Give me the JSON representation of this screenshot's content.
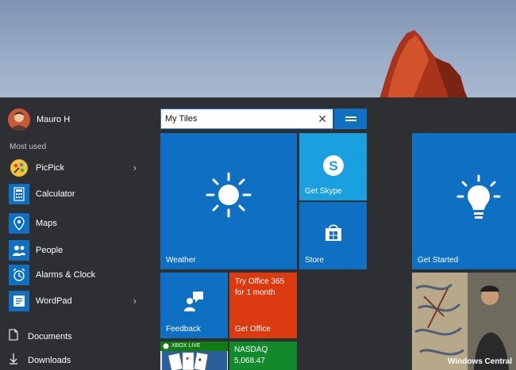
{
  "user": {
    "name": "Mauro H"
  },
  "most_used": {
    "heading": "Most used"
  },
  "apps": [
    {
      "label": "PicPick",
      "icon": "picpick-icon",
      "has_arrow": true
    },
    {
      "label": "Calculator",
      "icon": "calculator-icon",
      "has_arrow": false
    },
    {
      "label": "Maps",
      "icon": "maps-icon",
      "has_arrow": false
    },
    {
      "label": "People",
      "icon": "people-icon",
      "has_arrow": false
    },
    {
      "label": "Alarms & Clock",
      "icon": "alarm-clock-icon",
      "has_arrow": false
    },
    {
      "label": "WordPad",
      "icon": "wordpad-icon",
      "has_arrow": true
    }
  ],
  "system": [
    {
      "label": "Documents",
      "icon": "document-icon"
    },
    {
      "label": "Downloads",
      "icon": "download-icon"
    }
  ],
  "search": {
    "value": "My Tiles"
  },
  "tiles": {
    "weather": {
      "label": "Weather"
    },
    "skype": {
      "label": "Get Skype"
    },
    "store": {
      "label": "Store"
    },
    "get_started": {
      "label": "Get Started"
    },
    "feedback": {
      "label": "Feedback"
    },
    "office": {
      "promo": "Try Office 365 for 1 month",
      "label": "Get Office"
    },
    "xbox": {
      "badge": "XBOX LIVE"
    },
    "nasdaq": {
      "name": "NASDAQ",
      "value": "5,068.47"
    },
    "photo": {
      "watermark": "Windows Central"
    }
  },
  "colors": {
    "tile_blue": "#0f6fc3",
    "tile_light_blue": "#1aa0df",
    "tile_orange": "#dc3b12",
    "tile_green": "#128a2c",
    "menu_bg": "#2a2b2d"
  }
}
